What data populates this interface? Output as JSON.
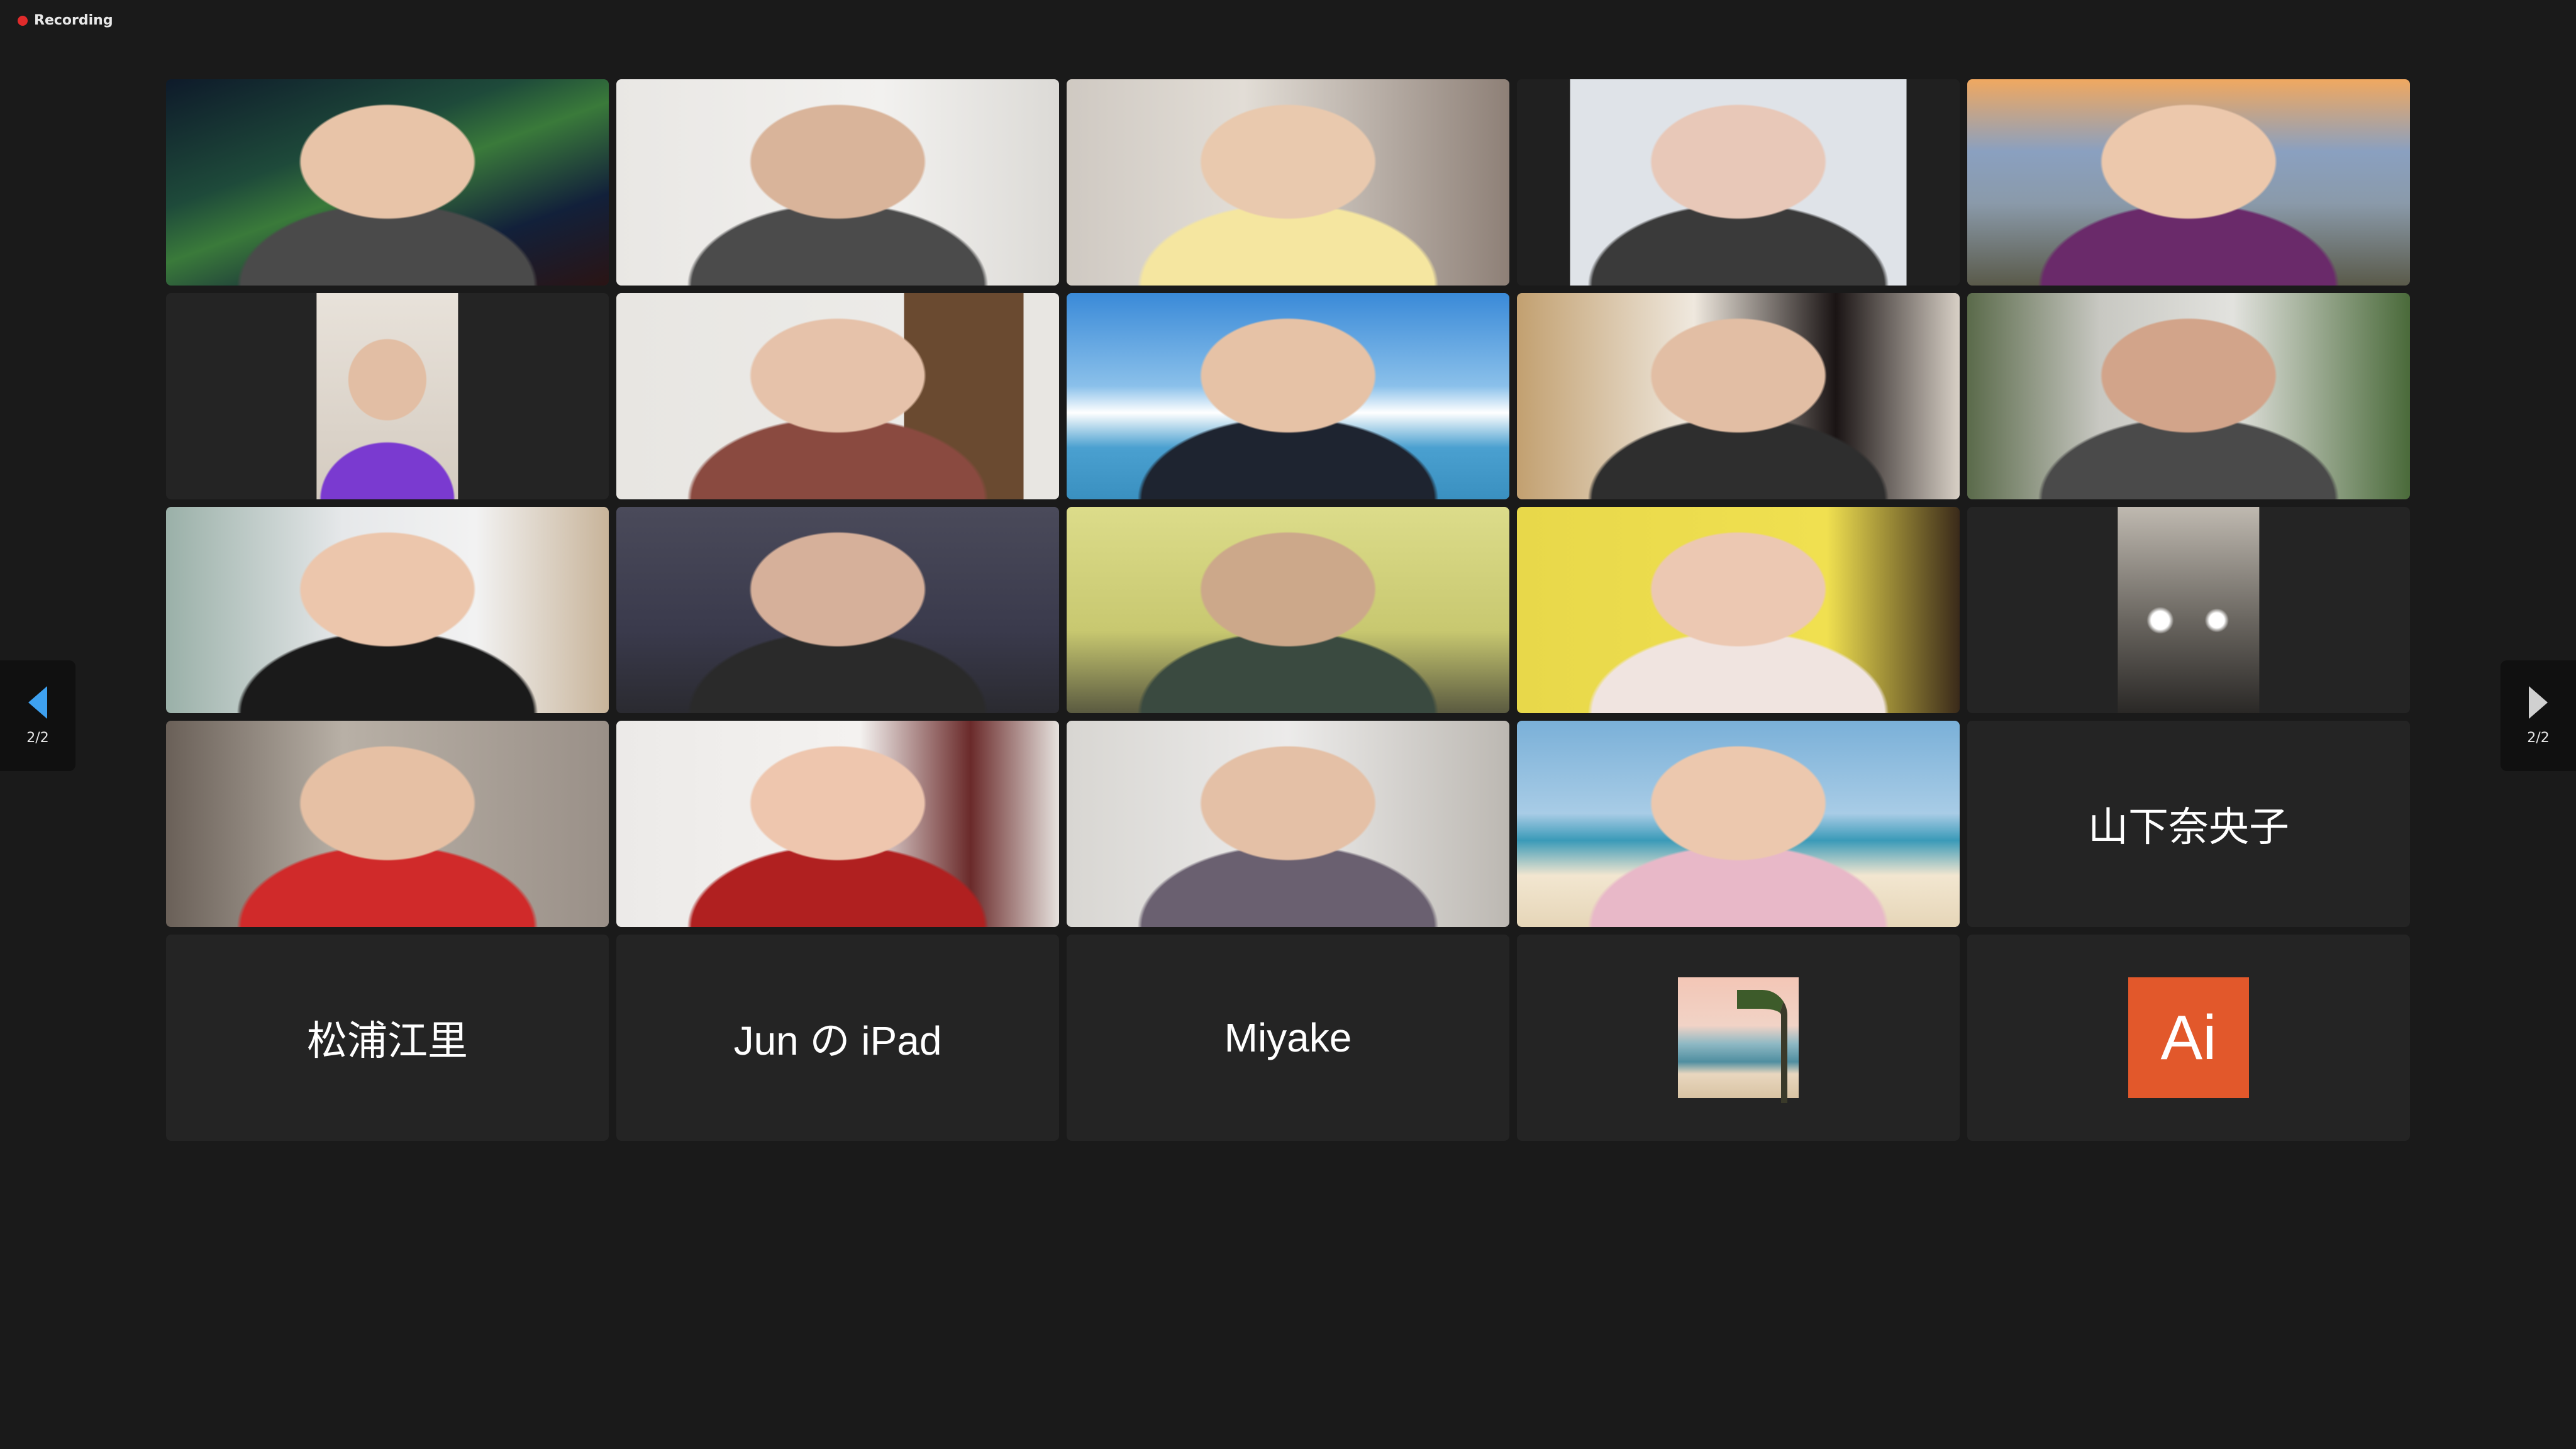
{
  "recording": {
    "label": "Recording"
  },
  "pagination": {
    "left_label": "2/2",
    "right_label": "2/2"
  },
  "name_tiles": {
    "yamashita": "山下奈央子",
    "matsuura": "松浦江里",
    "jun": "Jun の iPad",
    "miyake": "Miyake"
  },
  "avatar_tiles": {
    "ai_label": "Ai"
  },
  "colors": {
    "background": "#1a1a1a",
    "tile": "#242424",
    "recording_dot": "#e02b2b",
    "nav_arrow": "#3ea1f0",
    "ai_avatar": "#e2582b"
  }
}
